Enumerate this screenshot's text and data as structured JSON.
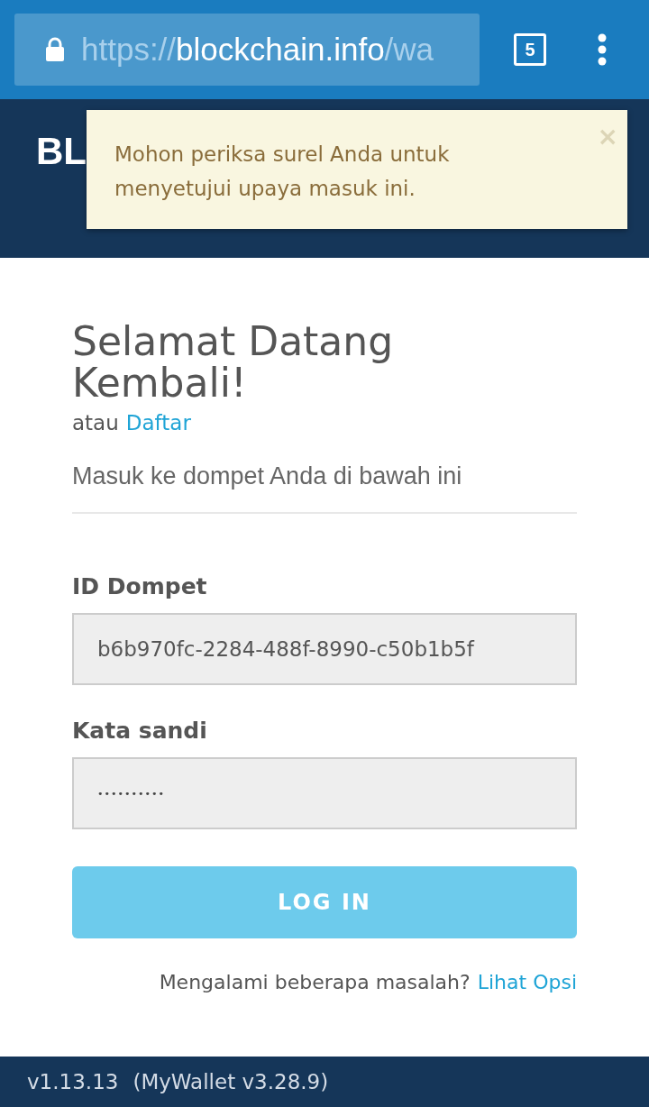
{
  "browser": {
    "url": {
      "scheme": "https://",
      "host": "blockchain.info",
      "path": "/wa"
    },
    "tab_count": "5"
  },
  "header": {
    "logo": "BL"
  },
  "alert": {
    "message": "Mohon periksa surel Anda untuk menyetujui upaya masuk ini.",
    "close": "×"
  },
  "login": {
    "title": "Selamat Datang Kembali!",
    "signup_prefix": "atau",
    "signup_link": "Daftar",
    "subtitle": "Masuk ke dompet Anda di bawah ini",
    "fields": [
      {
        "kind": "text",
        "label": "ID Dompet",
        "value": "b6b970fc-2284-488f-8990-c50b1b5f"
      },
      {
        "kind": "password",
        "label": "Kata sandi",
        "value": "••••••••••"
      }
    ],
    "button": "LOG IN",
    "help_text": "Mengalami beberapa masalah?",
    "help_link": "Lihat Opsi"
  },
  "footer": {
    "version": "v1.13.13",
    "wallet_version": "(MyWallet v3.28.9)"
  }
}
